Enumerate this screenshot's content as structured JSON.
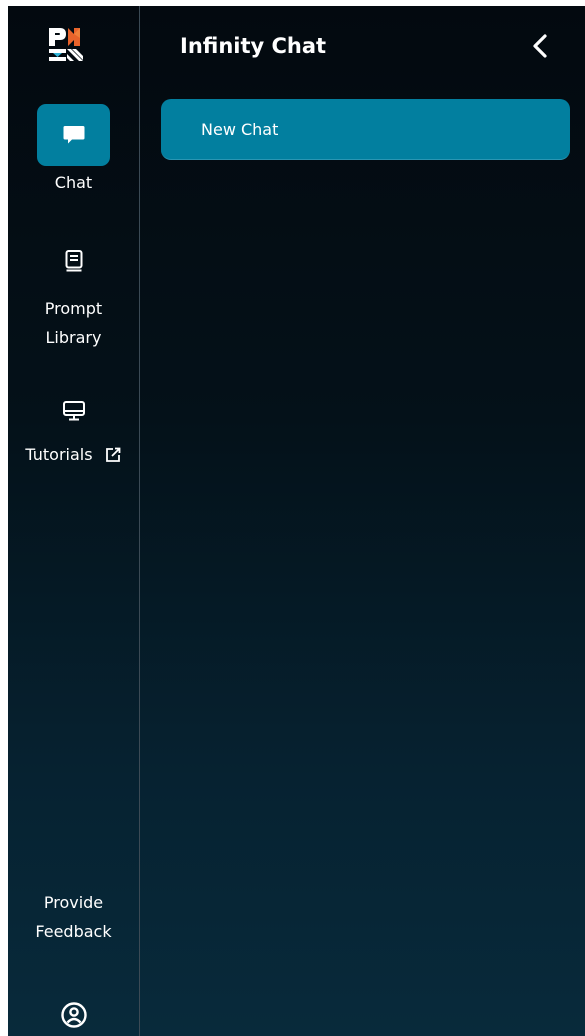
{
  "header": {
    "title": "Infinity Chat"
  },
  "sidebar": {
    "items": [
      {
        "label": "Chat",
        "icon": "chat-bubble-icon",
        "active": true
      },
      {
        "label_line1": "Prompt",
        "label_line2": "Library",
        "icon": "book-icon"
      },
      {
        "label": "Tutorials",
        "icon": "monitor-icon",
        "external_icon": "external-link-icon"
      }
    ],
    "feedback": {
      "line1": "Provide",
      "line2": "Feedback"
    },
    "profile_icon": "user-circle-icon"
  },
  "main": {
    "new_chat_label": "New Chat"
  },
  "colors": {
    "accent": "#027f9f",
    "background_top": "#03090f",
    "background_bottom": "#082a3b",
    "divider": "#3b4a55",
    "text": "#ffffff"
  }
}
